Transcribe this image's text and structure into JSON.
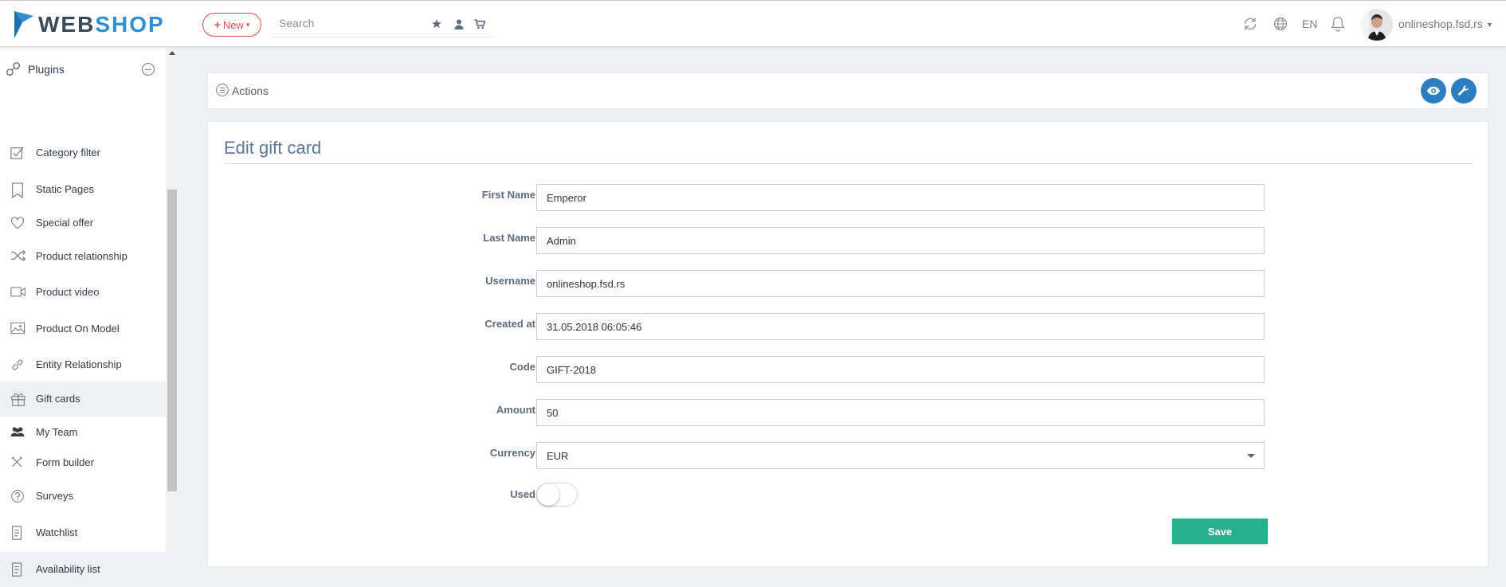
{
  "header": {
    "logo_web": "WEB",
    "logo_shop": "SHOP",
    "new_label": "New",
    "search_placeholder": "Search",
    "language": "EN",
    "user_name": "onlineshop.fsd.rs",
    "accent_color": "#2f8fce",
    "new_color": "#e04a4a"
  },
  "sidebar": {
    "section_title": "Plugins",
    "items": [
      {
        "label": "Category filter",
        "icon": "checkbox-icon"
      },
      {
        "label": "Static Pages",
        "icon": "bookmark-icon"
      },
      {
        "label": "Special offer",
        "icon": "heart-icon"
      },
      {
        "label": "Product relationship",
        "icon": "shuffle-icon"
      },
      {
        "label": "Product video",
        "icon": "video-icon"
      },
      {
        "label": "Product On Model",
        "icon": "image-icon"
      },
      {
        "label": "Entity Relationship",
        "icon": "link-icon"
      },
      {
        "label": "Gift cards",
        "icon": "gift-icon",
        "active": true
      },
      {
        "label": "My Team",
        "icon": "team-icon"
      },
      {
        "label": "Form builder",
        "icon": "tools-icon"
      },
      {
        "label": "Surveys",
        "icon": "question-icon"
      },
      {
        "label": "Watchlist",
        "icon": "list-icon"
      },
      {
        "label": "Availability list",
        "icon": "list-icon"
      }
    ]
  },
  "actions": {
    "label": "Actions"
  },
  "form": {
    "title": "Edit gift card",
    "fields": {
      "first_name": {
        "label": "First Name",
        "value": "Emperor"
      },
      "last_name": {
        "label": "Last Name",
        "value": "Admin"
      },
      "username": {
        "label": "Username",
        "value": "onlineshop.fsd.rs"
      },
      "created_at": {
        "label": "Created at",
        "value": "31.05.2018 06:05:46"
      },
      "code": {
        "label": "Code",
        "value": "GIFT-2018"
      },
      "amount": {
        "label": "Amount",
        "value": "50"
      },
      "currency": {
        "label": "Currency",
        "value": "EUR"
      },
      "used": {
        "label": "Used",
        "value": false
      }
    },
    "save_label": "Save",
    "save_color": "#28b08e"
  }
}
